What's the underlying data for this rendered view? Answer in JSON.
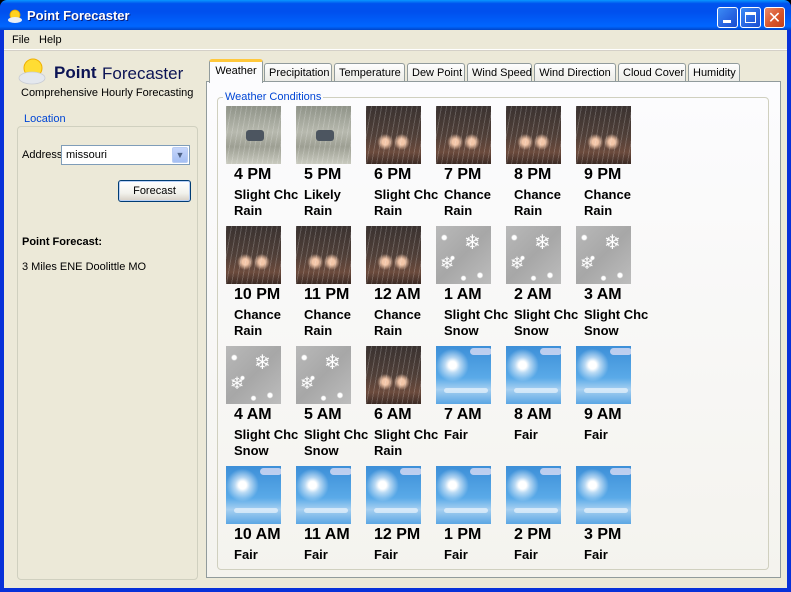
{
  "window": {
    "title": "Point Forecaster",
    "controls": {
      "minimize": "minimize",
      "maximize": "maximize",
      "close": "✕"
    }
  },
  "menu": {
    "items": [
      "File",
      "Help"
    ]
  },
  "logo": {
    "word1": "Point",
    "word2": "Forecaster",
    "tagline": "Comprehensive Hourly Forecasting",
    "icon": "partly-sunny-icon"
  },
  "location": {
    "legend": "Location",
    "address_label": "Address",
    "address_value": "missouri",
    "forecast_button": "Forecast",
    "point_forecast_label": "Point Forecast:",
    "point_forecast_value": "3 Miles ENE Doolittle MO"
  },
  "tabs": [
    {
      "label": "Weather",
      "active": true
    },
    {
      "label": "Precipitation",
      "active": false
    },
    {
      "label": "Temperature",
      "active": false
    },
    {
      "label": "Dew Point",
      "active": false
    },
    {
      "label": "Wind Speed",
      "active": false
    },
    {
      "label": "Wind Direction",
      "active": false
    },
    {
      "label": "Cloud Cover",
      "active": false
    },
    {
      "label": "Humidity",
      "active": false
    }
  ],
  "conditions": {
    "legend": "Weather Conditions",
    "hours": [
      {
        "time": "4 PM",
        "line1": "Slight Chc",
        "line2": "Rain",
        "icon": "rain-day"
      },
      {
        "time": "5 PM",
        "line1": "Likely",
        "line2": "Rain",
        "icon": "rain-day"
      },
      {
        "time": "6 PM",
        "line1": "Slight Chc",
        "line2": "Rain",
        "icon": "rain-night"
      },
      {
        "time": "7 PM",
        "line1": "Chance",
        "line2": "Rain",
        "icon": "rain-night"
      },
      {
        "time": "8 PM",
        "line1": "Chance",
        "line2": "Rain",
        "icon": "rain-night"
      },
      {
        "time": "9 PM",
        "line1": "Chance",
        "line2": "Rain",
        "icon": "rain-night"
      },
      {
        "time": "10 PM",
        "line1": "Chance",
        "line2": "Rain",
        "icon": "rain-night"
      },
      {
        "time": "11 PM",
        "line1": "Chance",
        "line2": "Rain",
        "icon": "rain-night"
      },
      {
        "time": "12 AM",
        "line1": "Chance",
        "line2": "Rain",
        "icon": "rain-night"
      },
      {
        "time": "1 AM",
        "line1": "Slight Chc",
        "line2": "Snow",
        "icon": "snow"
      },
      {
        "time": "2 AM",
        "line1": "Slight Chc",
        "line2": "Snow",
        "icon": "snow"
      },
      {
        "time": "3 AM",
        "line1": "Slight Chc",
        "line2": "Snow",
        "icon": "snow"
      },
      {
        "time": "4 AM",
        "line1": "Slight Chc",
        "line2": "Snow",
        "icon": "snow"
      },
      {
        "time": "5 AM",
        "line1": "Slight Chc",
        "line2": "Snow",
        "icon": "snow"
      },
      {
        "time": "6 AM",
        "line1": "Slight Chc",
        "line2": "Rain",
        "icon": "rain-night"
      },
      {
        "time": "7 AM",
        "line1": "Fair",
        "line2": "",
        "icon": "fair"
      },
      {
        "time": "8 AM",
        "line1": "Fair",
        "line2": "",
        "icon": "fair"
      },
      {
        "time": "9 AM",
        "line1": "Fair",
        "line2": "",
        "icon": "fair"
      },
      {
        "time": "10 AM",
        "line1": "Fair",
        "line2": "",
        "icon": "fair"
      },
      {
        "time": "11 AM",
        "line1": "Fair",
        "line2": "",
        "icon": "fair"
      },
      {
        "time": "12 PM",
        "line1": "Fair",
        "line2": "",
        "icon": "fair"
      },
      {
        "time": "1 PM",
        "line1": "Fair",
        "line2": "",
        "icon": "fair"
      },
      {
        "time": "2 PM",
        "line1": "Fair",
        "line2": "",
        "icon": "fair"
      },
      {
        "time": "3 PM",
        "line1": "Fair",
        "line2": "",
        "icon": "fair"
      }
    ]
  },
  "colors": {
    "accent": "#0046d5",
    "titlebar": "#0053ee",
    "tab_highlight": "#ffc83c"
  }
}
